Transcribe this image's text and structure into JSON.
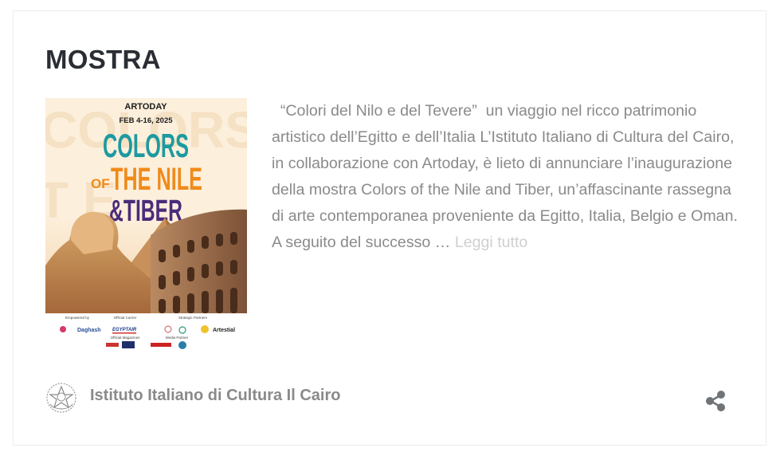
{
  "post": {
    "title": "MOSTRA",
    "excerpt": "  “Colori del Nilo e del Tevere”  un viaggio nel ricco patrimonio artistico dell’Egitto e dell’Italia L’Istituto Italiano di Cultura del Cairo, in collaborazione con Artoday, è lieto di annunciare l’inaugurazione della mostra Colors of the Nile and Tiber, un’affascinante rassegna di arte contemporanea proveniente da Egitto, Italia, Belgio e Oman. A seguito del successo … ",
    "read_more": "Leggi tutto",
    "author": "Istituto Italiano di Cultura Il Cairo"
  },
  "poster": {
    "brand": "ARTODAY",
    "dates": "FEB 4-16, 2025",
    "title_line1": "COLORS",
    "title_of": "OF",
    "title_line2": "THE NILE",
    "title_line3": "&TIBER",
    "sponsor_labels": [
      "Empowered by",
      "Official Carrier",
      "Strategic Partners",
      "Official Magazines",
      "Media Partner"
    ],
    "sponsor_logos": [
      "Daghash",
      "EGYPTAIR",
      "Artestial"
    ]
  },
  "colors": {
    "title": "#2a2e34",
    "body_text": "#8a8a8a",
    "read_more": "#cfcfcf",
    "poster_teal": "#1c9aa0",
    "poster_orange": "#f08a1a",
    "poster_purple": "#4b2c7a",
    "poster_bg": "#fcefdc"
  },
  "icons": {
    "author": "republic-emblem-icon",
    "share": "share-icon"
  }
}
